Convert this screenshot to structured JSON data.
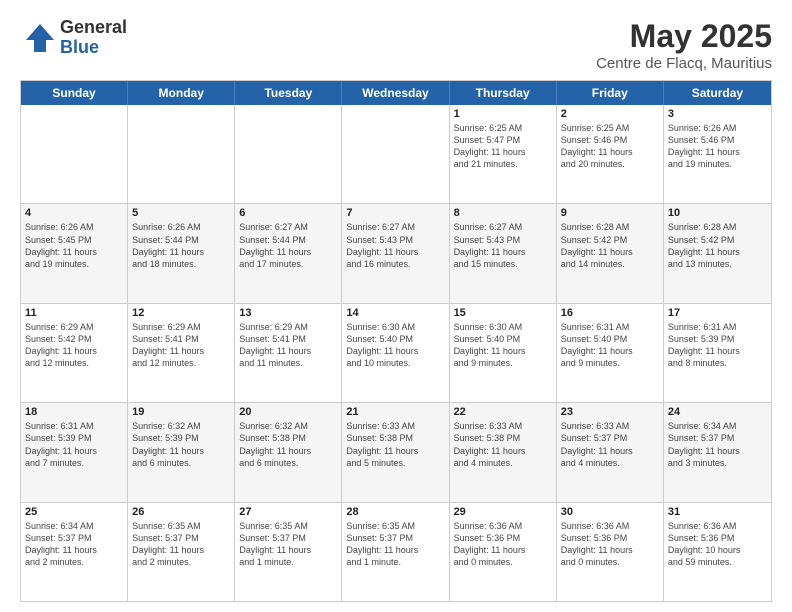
{
  "header": {
    "logo_general": "General",
    "logo_blue": "Blue",
    "title": "May 2025",
    "subtitle": "Centre de Flacq, Mauritius"
  },
  "weekdays": [
    "Sunday",
    "Monday",
    "Tuesday",
    "Wednesday",
    "Thursday",
    "Friday",
    "Saturday"
  ],
  "rows": [
    [
      {
        "day": "",
        "info": ""
      },
      {
        "day": "",
        "info": ""
      },
      {
        "day": "",
        "info": ""
      },
      {
        "day": "",
        "info": ""
      },
      {
        "day": "1",
        "info": "Sunrise: 6:25 AM\nSunset: 5:47 PM\nDaylight: 11 hours\nand 21 minutes."
      },
      {
        "day": "2",
        "info": "Sunrise: 6:25 AM\nSunset: 5:46 PM\nDaylight: 11 hours\nand 20 minutes."
      },
      {
        "day": "3",
        "info": "Sunrise: 6:26 AM\nSunset: 5:46 PM\nDaylight: 11 hours\nand 19 minutes."
      }
    ],
    [
      {
        "day": "4",
        "info": "Sunrise: 6:26 AM\nSunset: 5:45 PM\nDaylight: 11 hours\nand 19 minutes."
      },
      {
        "day": "5",
        "info": "Sunrise: 6:26 AM\nSunset: 5:44 PM\nDaylight: 11 hours\nand 18 minutes."
      },
      {
        "day": "6",
        "info": "Sunrise: 6:27 AM\nSunset: 5:44 PM\nDaylight: 11 hours\nand 17 minutes."
      },
      {
        "day": "7",
        "info": "Sunrise: 6:27 AM\nSunset: 5:43 PM\nDaylight: 11 hours\nand 16 minutes."
      },
      {
        "day": "8",
        "info": "Sunrise: 6:27 AM\nSunset: 5:43 PM\nDaylight: 11 hours\nand 15 minutes."
      },
      {
        "day": "9",
        "info": "Sunrise: 6:28 AM\nSunset: 5:42 PM\nDaylight: 11 hours\nand 14 minutes."
      },
      {
        "day": "10",
        "info": "Sunrise: 6:28 AM\nSunset: 5:42 PM\nDaylight: 11 hours\nand 13 minutes."
      }
    ],
    [
      {
        "day": "11",
        "info": "Sunrise: 6:29 AM\nSunset: 5:42 PM\nDaylight: 11 hours\nand 12 minutes."
      },
      {
        "day": "12",
        "info": "Sunrise: 6:29 AM\nSunset: 5:41 PM\nDaylight: 11 hours\nand 12 minutes."
      },
      {
        "day": "13",
        "info": "Sunrise: 6:29 AM\nSunset: 5:41 PM\nDaylight: 11 hours\nand 11 minutes."
      },
      {
        "day": "14",
        "info": "Sunrise: 6:30 AM\nSunset: 5:40 PM\nDaylight: 11 hours\nand 10 minutes."
      },
      {
        "day": "15",
        "info": "Sunrise: 6:30 AM\nSunset: 5:40 PM\nDaylight: 11 hours\nand 9 minutes."
      },
      {
        "day": "16",
        "info": "Sunrise: 6:31 AM\nSunset: 5:40 PM\nDaylight: 11 hours\nand 9 minutes."
      },
      {
        "day": "17",
        "info": "Sunrise: 6:31 AM\nSunset: 5:39 PM\nDaylight: 11 hours\nand 8 minutes."
      }
    ],
    [
      {
        "day": "18",
        "info": "Sunrise: 6:31 AM\nSunset: 5:39 PM\nDaylight: 11 hours\nand 7 minutes."
      },
      {
        "day": "19",
        "info": "Sunrise: 6:32 AM\nSunset: 5:39 PM\nDaylight: 11 hours\nand 6 minutes."
      },
      {
        "day": "20",
        "info": "Sunrise: 6:32 AM\nSunset: 5:38 PM\nDaylight: 11 hours\nand 6 minutes."
      },
      {
        "day": "21",
        "info": "Sunrise: 6:33 AM\nSunset: 5:38 PM\nDaylight: 11 hours\nand 5 minutes."
      },
      {
        "day": "22",
        "info": "Sunrise: 6:33 AM\nSunset: 5:38 PM\nDaylight: 11 hours\nand 4 minutes."
      },
      {
        "day": "23",
        "info": "Sunrise: 6:33 AM\nSunset: 5:37 PM\nDaylight: 11 hours\nand 4 minutes."
      },
      {
        "day": "24",
        "info": "Sunrise: 6:34 AM\nSunset: 5:37 PM\nDaylight: 11 hours\nand 3 minutes."
      }
    ],
    [
      {
        "day": "25",
        "info": "Sunrise: 6:34 AM\nSunset: 5:37 PM\nDaylight: 11 hours\nand 2 minutes."
      },
      {
        "day": "26",
        "info": "Sunrise: 6:35 AM\nSunset: 5:37 PM\nDaylight: 11 hours\nand 2 minutes."
      },
      {
        "day": "27",
        "info": "Sunrise: 6:35 AM\nSunset: 5:37 PM\nDaylight: 11 hours\nand 1 minute."
      },
      {
        "day": "28",
        "info": "Sunrise: 6:35 AM\nSunset: 5:37 PM\nDaylight: 11 hours\nand 1 minute."
      },
      {
        "day": "29",
        "info": "Sunrise: 6:36 AM\nSunset: 5:36 PM\nDaylight: 11 hours\nand 0 minutes."
      },
      {
        "day": "30",
        "info": "Sunrise: 6:36 AM\nSunset: 5:36 PM\nDaylight: 11 hours\nand 0 minutes."
      },
      {
        "day": "31",
        "info": "Sunrise: 6:36 AM\nSunset: 5:36 PM\nDaylight: 10 hours\nand 59 minutes."
      }
    ]
  ]
}
